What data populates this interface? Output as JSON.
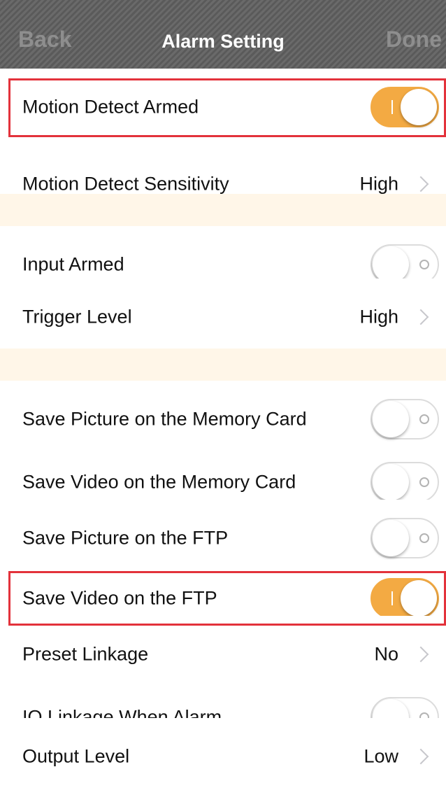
{
  "navbar": {
    "back_label": "Back",
    "title": "Alarm Setting",
    "done_label": "Done"
  },
  "rows": {
    "motion_detect_armed": {
      "label": "Motion Detect Armed",
      "state": "on"
    },
    "motion_detect_sensitivity": {
      "label": "Motion Detect Sensitivity",
      "value": "High"
    },
    "input_armed": {
      "label": "Input Armed",
      "state": "off"
    },
    "trigger_level": {
      "label": "Trigger Level",
      "value": "High"
    },
    "save_picture_memory_card": {
      "label": "Save Picture on the Memory Card",
      "state": "off"
    },
    "save_video_memory_card": {
      "label": "Save Video on the Memory Card",
      "state": "off"
    },
    "save_picture_ftp": {
      "label": "Save Picture on the FTP",
      "state": "off"
    },
    "save_video_ftp": {
      "label": "Save Video on the FTP",
      "state": "on"
    },
    "preset_linkage": {
      "label": "Preset Linkage",
      "value": "No"
    },
    "io_linkage_when_alarm": {
      "label": "IO Linkage When Alarm",
      "state": "off"
    },
    "output_level": {
      "label": "Output Level",
      "value": "Low"
    }
  },
  "colors": {
    "toggle_on": "#f3aa43",
    "section_spacer": "#fff6e8",
    "highlight_border": "#e3323b",
    "navbar": "#616161"
  }
}
